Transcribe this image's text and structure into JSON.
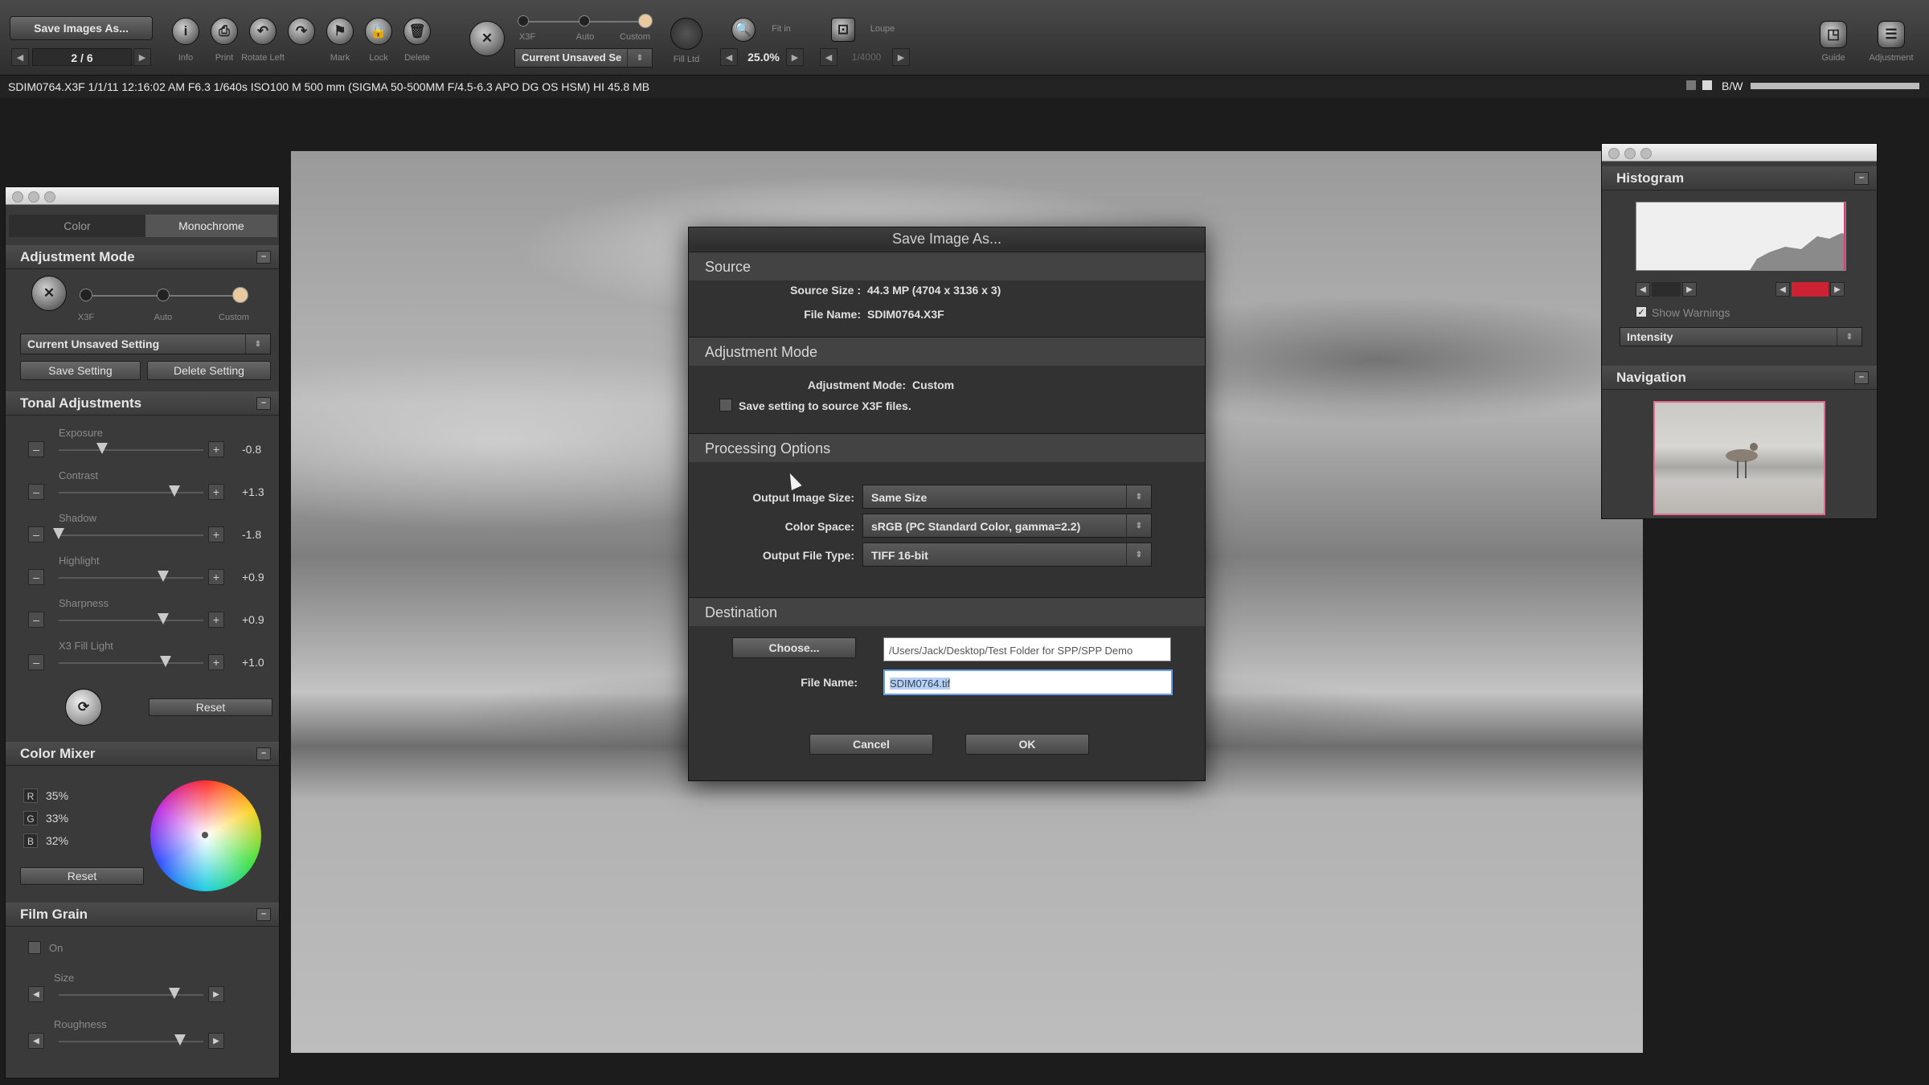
{
  "toolbar": {
    "save_images_label": "Save Images As...",
    "page_counter": "2 / 6",
    "icons": [
      {
        "name": "info-icon",
        "glyph": "i",
        "label": "Info"
      },
      {
        "name": "print-icon",
        "glyph": "⎙",
        "label": "Print"
      },
      {
        "name": "rotate-left-icon",
        "glyph": "↶",
        "label": "Rotate Left"
      },
      {
        "name": "rotate-right-icon",
        "glyph": "↷",
        "label": ""
      },
      {
        "name": "mark-icon",
        "glyph": "⚑",
        "label": "Mark"
      },
      {
        "name": "lock-icon",
        "glyph": "🔒",
        "label": "Lock"
      },
      {
        "name": "delete-icon",
        "glyph": "🗑",
        "label": "Delete"
      }
    ],
    "mode_labels": [
      "X3F",
      "Auto",
      "Custom"
    ],
    "setting_select": "Current Unsaved Se",
    "fill_light_label": "Fill Ltd",
    "zoom_value": "25.0%",
    "fit_label": "Fit in",
    "loupe_label": "Loupe",
    "lower_value": "1/4000",
    "right_icons": [
      {
        "name": "guide-icon",
        "glyph": "◳",
        "label": "Guide"
      },
      {
        "name": "adjustment-icon",
        "glyph": "☰",
        "label": "Adjustment"
      }
    ],
    "bw_label": "B/W"
  },
  "info_bar": {
    "text": "SDIM0764.X3F 1/1/11 12:16:02 AM F6.3 1/640s ISO100 M 500 mm (SIGMA 50-500MM F/4.5-6.3 APO DG OS HSM) HI 45.8 MB"
  },
  "left_panel": {
    "tabs": [
      "Color",
      "Monochrome"
    ],
    "adjustment_mode": {
      "title": "Adjustment Mode",
      "mode_labels": [
        "X3F",
        "Auto",
        "Custom"
      ],
      "setting_select": "Current Unsaved Setting",
      "save_label": "Save Setting",
      "delete_label": "Delete Setting"
    },
    "tonal": {
      "title": "Tonal Adjustments",
      "sliders": [
        {
          "label": "Exposure",
          "value": "-0.8",
          "level": 0.3
        },
        {
          "label": "Contrast",
          "value": "+1.3",
          "level": 0.8
        },
        {
          "label": "Shadow",
          "value": "-1.8",
          "level": 0.0
        },
        {
          "label": "Highlight",
          "value": "+0.9",
          "level": 0.72
        },
        {
          "label": "Sharpness",
          "value": "+0.9",
          "level": 0.72
        },
        {
          "label": "X3 Fill Light",
          "value": "+1.0",
          "level": 0.74
        }
      ],
      "reset_label": "Reset"
    },
    "color_mixer": {
      "title": "Color Mixer",
      "channels": [
        {
          "key": "R",
          "value": "35%"
        },
        {
          "key": "G",
          "value": "33%"
        },
        {
          "key": "B",
          "value": "32%"
        }
      ],
      "reset_label": "Reset"
    },
    "film_grain": {
      "title": "Film Grain",
      "on_label": "On",
      "sliders": [
        {
          "label": "Size",
          "level": 0.8
        },
        {
          "label": "Roughness",
          "level": 0.84
        }
      ]
    }
  },
  "dialog": {
    "title": "Save Image As...",
    "source": {
      "header": "Source",
      "size_label": "Source Size :",
      "size_value": "44.3 MP (4704 x 3136 x 3)",
      "file_label": "File Name:",
      "file_value": "SDIM0764.X3F"
    },
    "adjustment": {
      "header": "Adjustment Mode",
      "mode_label": "Adjustment Mode:",
      "mode_value": "Custom",
      "checkbox_label": "Save setting to source X3F files."
    },
    "processing": {
      "header": "Processing Options",
      "rows": [
        {
          "label": "Output Image Size:",
          "value": "Same Size"
        },
        {
          "label": "Color Space:",
          "value": "sRGB (PC Standard Color, gamma=2.2)"
        },
        {
          "label": "Output File Type:",
          "value": "TIFF 16-bit"
        }
      ]
    },
    "destination": {
      "header": "Destination",
      "choose_label": "Choose...",
      "path_value": "/Users/Jack/Desktop/Test Folder for SPP/SPP Demo",
      "filename_label": "File Name:",
      "filename_value": "SDIM0764.tif"
    },
    "cancel_label": "Cancel",
    "ok_label": "OK"
  },
  "right_panel": {
    "histogram_title": "Histogram",
    "show_warnings_label": "Show Warnings",
    "channel_select": "Intensity",
    "navigation_title": "Navigation"
  }
}
